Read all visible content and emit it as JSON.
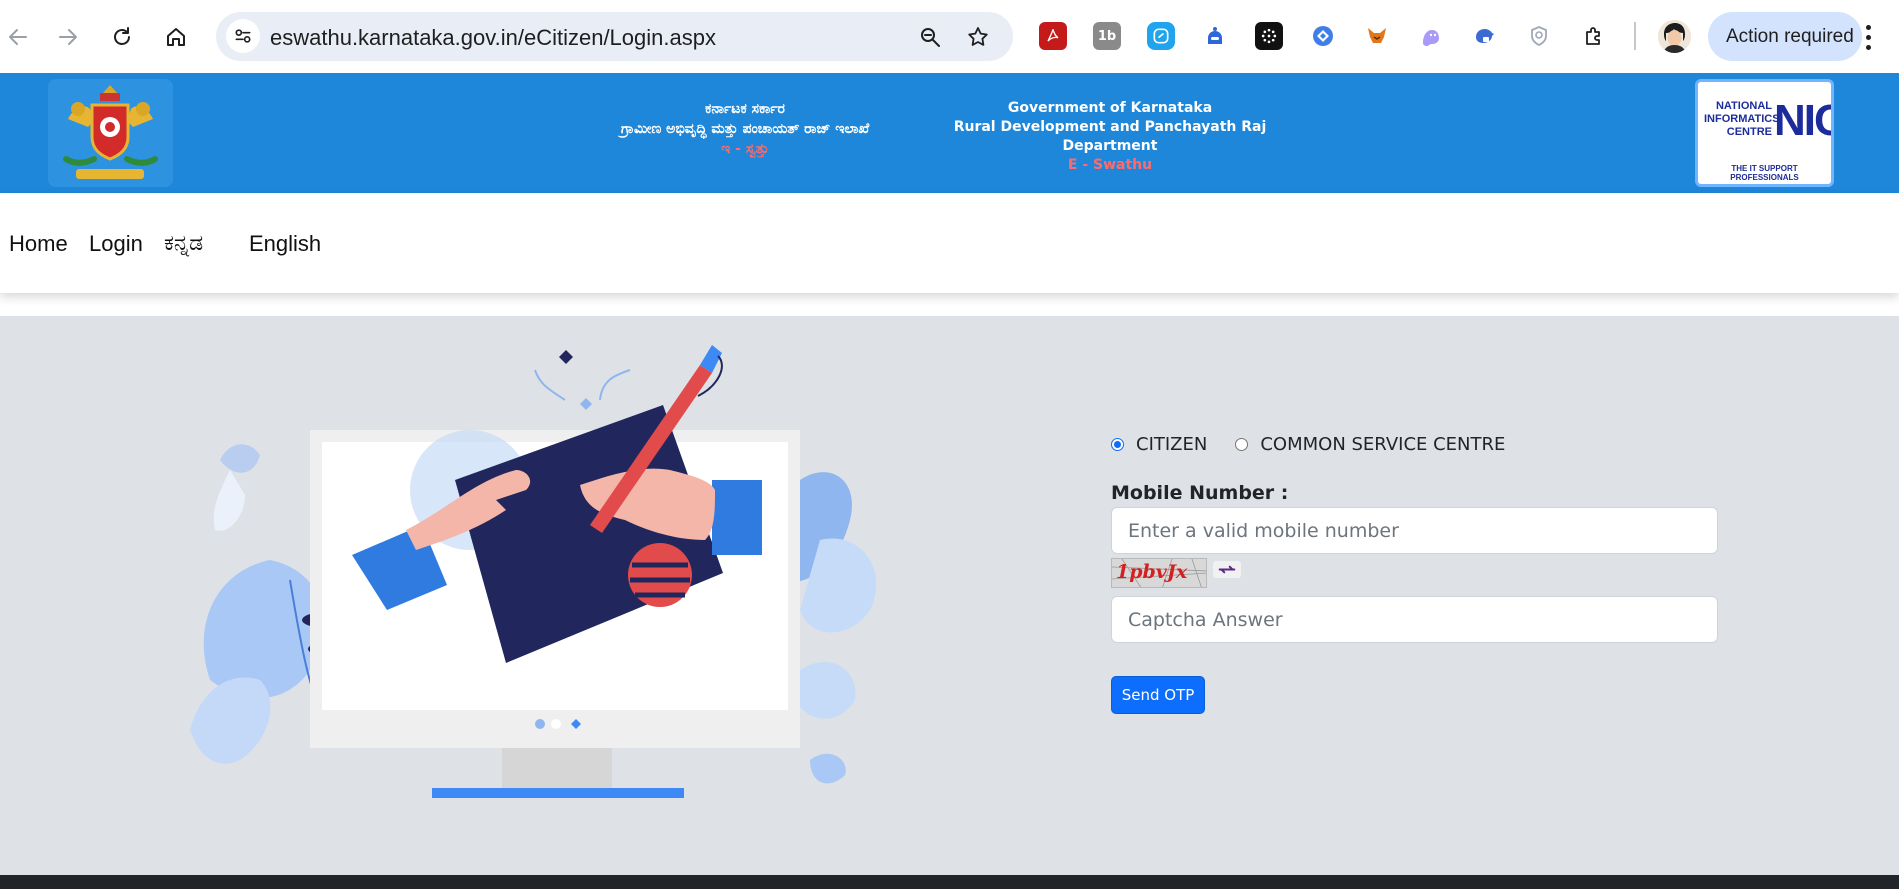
{
  "browser": {
    "url": "eswathu.karnataka.gov.in/eCitizen/Login.aspx",
    "action_label": "Action required",
    "extensions": [
      {
        "icon": "pdf-extension-icon",
        "color": "#c41a1a"
      },
      {
        "icon": "1b-extension-icon",
        "color": "#8a8a8a"
      },
      {
        "icon": "teal-extension-icon",
        "color": "#20a4ee"
      },
      {
        "icon": "blue-robot-extension-icon",
        "color": "#2f67d8"
      },
      {
        "icon": "black-grid-extension-icon",
        "color": "#111111"
      },
      {
        "icon": "blue-diamond-extension-icon",
        "color": "#3f7ee8"
      },
      {
        "icon": "fox-extension-icon",
        "color": "#e2761b"
      },
      {
        "icon": "ghost-extension-icon",
        "color": "#a89af6"
      },
      {
        "icon": "shield-lock-extension-icon",
        "color": "#3c6ad4"
      },
      {
        "icon": "shield-extension-icon",
        "color": "#a0a8b8"
      }
    ]
  },
  "header": {
    "kn_line1": "ಕರ್ನಾಟಕ ಸರ್ಕಾರ",
    "kn_line2": "ಗ್ರಾಮೀಣ ಅಭಿವೃದ್ಧಿ ಮತ್ತು ಪಂಚಾಯತ್ ರಾಜ್ ಇಲಾಖೆ",
    "kn_line3": "ಇ - ಸ್ವತ್ತು",
    "en_line1": "Government of Karnataka",
    "en_line2": "Rural Development and Panchayath Raj Department",
    "en_line3": "E - Swathu",
    "nic_lines": [
      "NATIONAL",
      "INFORMATICS",
      "CENTRE"
    ],
    "nic_big": "NIC",
    "nic_tag": "THE IT SUPPORT PROFESSIONALS",
    "colors": {
      "banner": "#1f87d9",
      "accent": "#ff6b6b"
    }
  },
  "nav": {
    "items": [
      "Home",
      "Login",
      "ಕನ್ನಡ",
      "English"
    ]
  },
  "login": {
    "roles": [
      {
        "label": "CITIZEN",
        "checked": true
      },
      {
        "label": "COMMON SERVICE CENTRE",
        "checked": false
      }
    ],
    "mobile_label": "Mobile Number :",
    "mobile_placeholder": "Enter a valid mobile number",
    "captcha_text": "1pbvJx",
    "captcha_placeholder": "Captcha Answer",
    "submit_label": "Send OTP",
    "colors": {
      "primary": "#0d6efd"
    }
  }
}
